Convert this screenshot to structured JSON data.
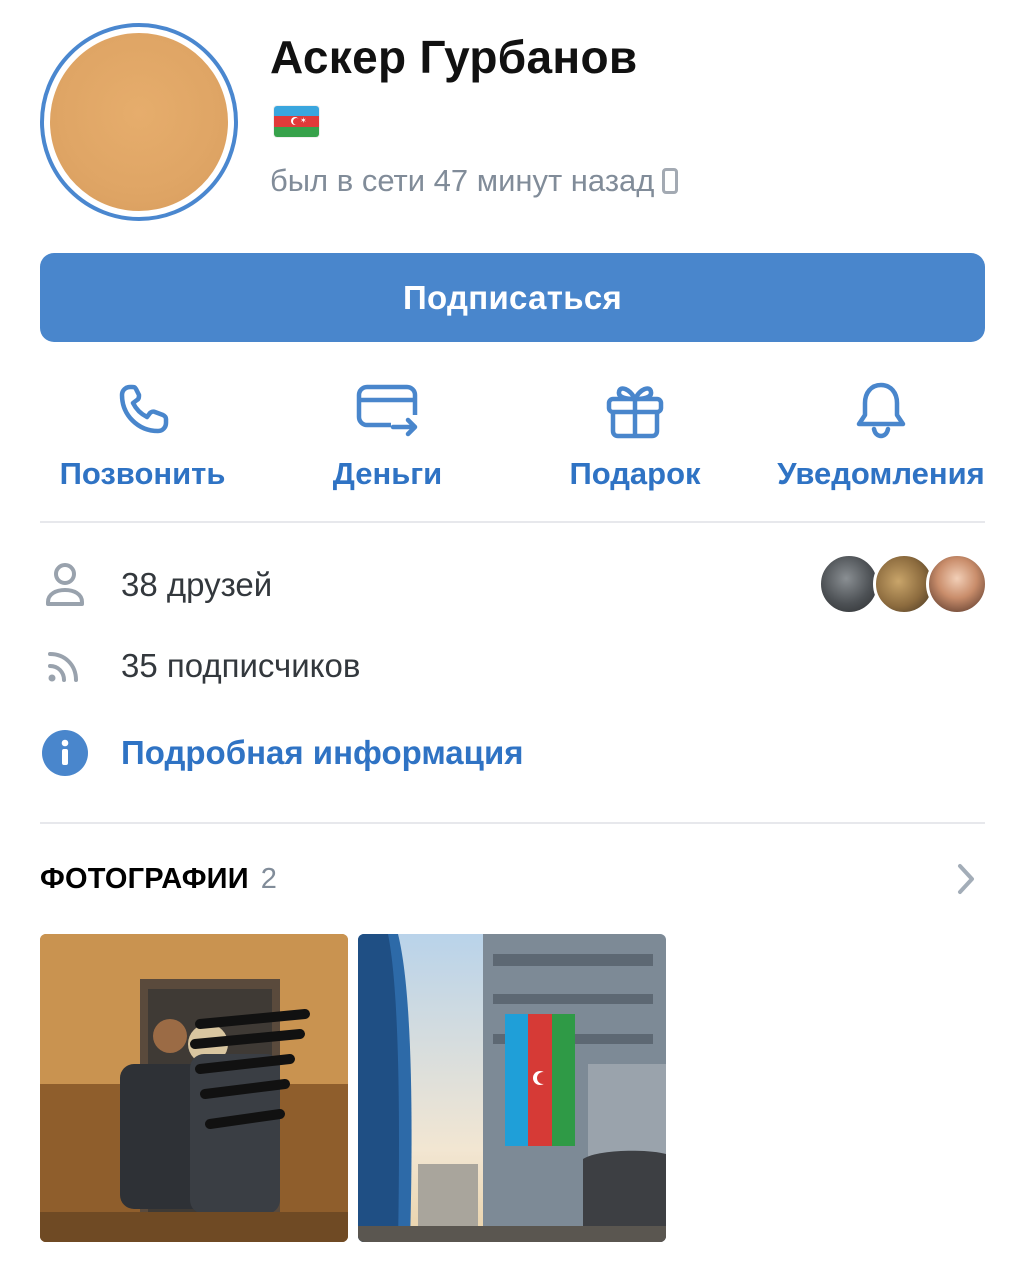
{
  "profile": {
    "name": "Аскер Гурбанов",
    "flag_emoji": "🇦🇿",
    "status": "был в сети 47 минут назад",
    "status_icon": "mobile-phone-icon",
    "avatar_color": "#dfa565"
  },
  "subscribe_button": {
    "label": "Подписаться"
  },
  "actions": [
    {
      "label": "Позвонить",
      "icon": "phone-icon"
    },
    {
      "label": "Деньги",
      "icon": "money-card-icon"
    },
    {
      "label": "Подарок",
      "icon": "gift-icon"
    },
    {
      "label": "Уведомления",
      "icon": "bell-icon"
    }
  ],
  "info": {
    "friends": {
      "text": "38 друзей",
      "icon": "person-icon"
    },
    "followers": {
      "text": "35 подписчиков",
      "icon": "rss-icon"
    },
    "details": {
      "text": "Подробная информация",
      "icon": "info-icon"
    }
  },
  "photos": {
    "title": "ФОТОГРАФИИ",
    "count": "2"
  },
  "colors": {
    "accent": "#4986cc",
    "link": "#2f73c4",
    "secondary_text": "#818c99",
    "divider": "#e7e8ec"
  }
}
